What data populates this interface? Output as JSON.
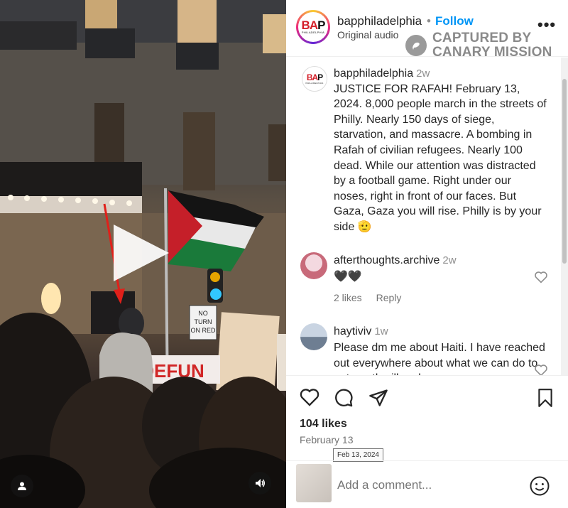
{
  "post": {
    "username": "bapphiladelphia",
    "follow_label": "Follow",
    "audio_label": "Original audio",
    "more_label": "•••",
    "dot": "•"
  },
  "avatar_logo": {
    "letters_b": "BA",
    "letters_p": "P",
    "subtitle": "PHILADELPHIA"
  },
  "watermark": {
    "line1": "CAPTURED BY",
    "line2": "CANARY MISSION"
  },
  "caption": {
    "username": "bapphiladelphia",
    "time": "2w",
    "text": "JUSTICE FOR RAFAH! February 13, 2024. 8,000 people march in the streets of Philly. Nearly 150 days of siege, starvation, and massacre. A bombing in Rafah of civilian refugees. Nearly 100 dead. While our attention was distracted by a football game. Right under our noses, right in front of our faces. But Gaza, Gaza you will rise. Philly is by your side",
    "emoji": "🫡"
  },
  "comments": [
    {
      "username": "afterthoughts.archive",
      "time": "2w",
      "text": "🖤🖤",
      "likes": "2 likes",
      "reply_label": "Reply"
    },
    {
      "username": "haytiviv",
      "time": "1w",
      "text": "Please dm me about Haiti. I have reached out everywhere about what we can do to get our the ill and"
    }
  ],
  "video_scene": {
    "sign_text": "NO TURN ON RED",
    "banner_text": "DEFUN"
  },
  "actions": {
    "likes_label": "104 likes",
    "date_label": "February 13",
    "tooltip": "Feb 13, 2024"
  },
  "add_comment": {
    "placeholder": "Add a comment..."
  },
  "colors": {
    "accent": "#0095f6",
    "text": "#262626",
    "muted": "#737373",
    "arrow": "#e0201a"
  }
}
